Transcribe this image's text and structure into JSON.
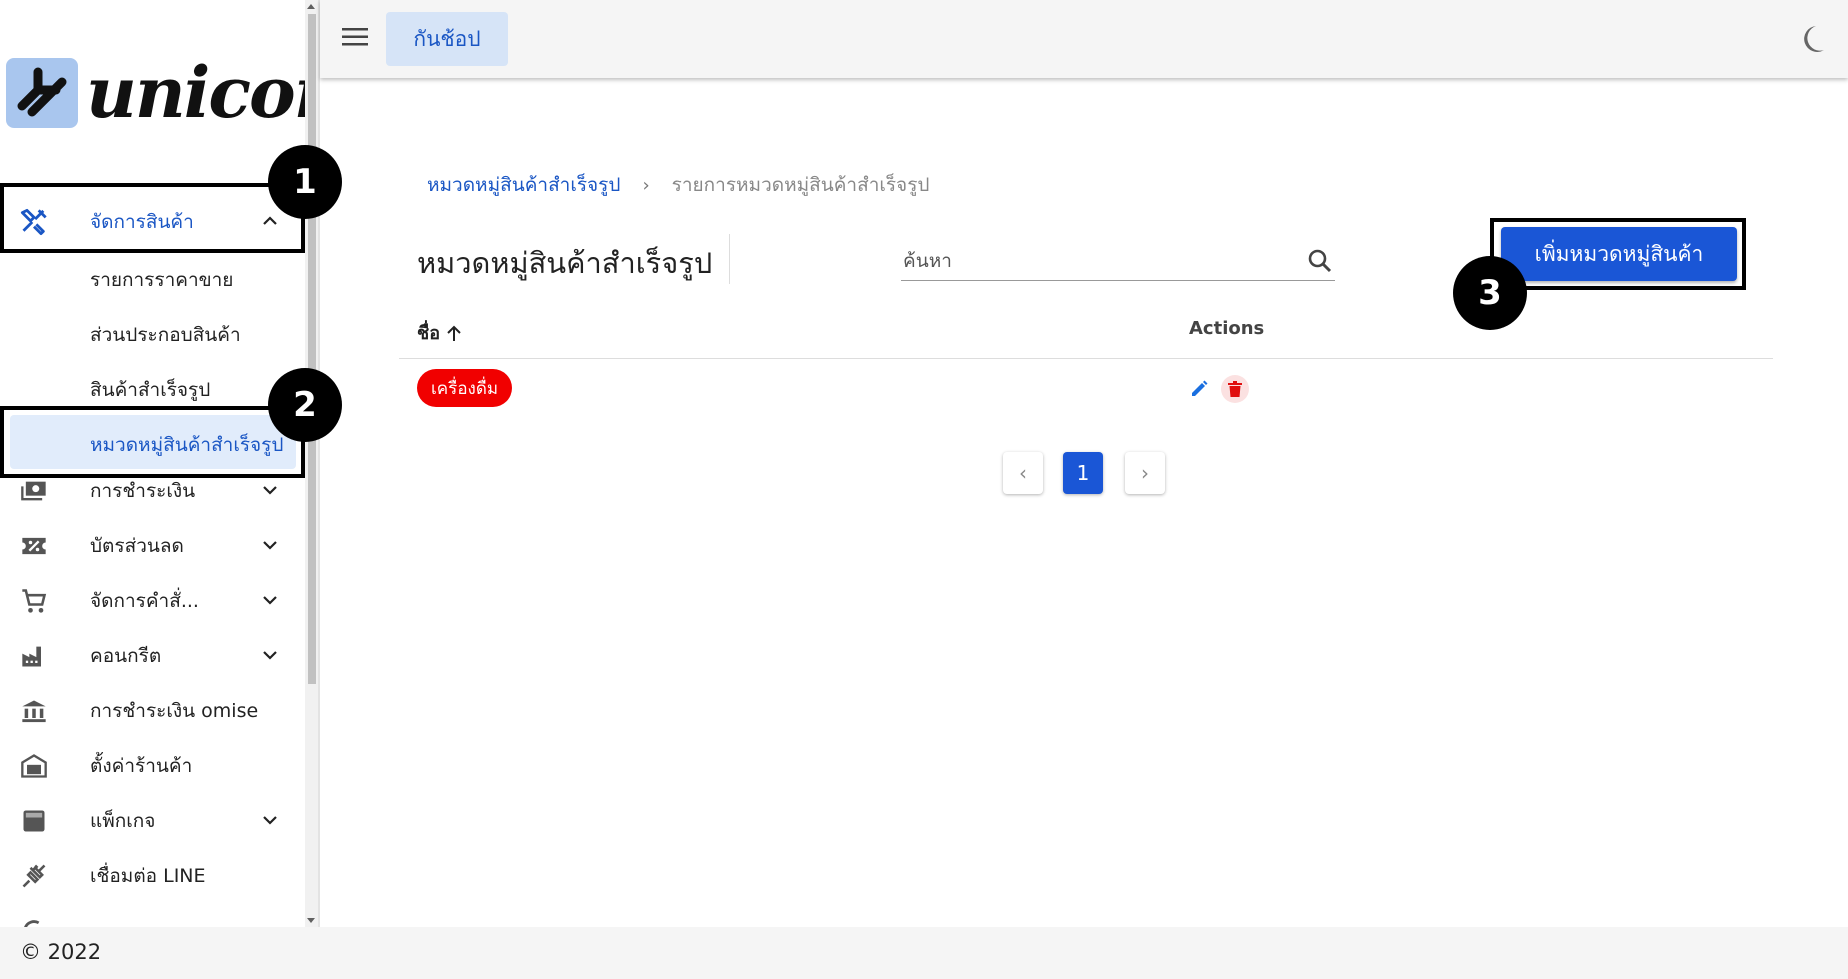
{
  "app": {
    "logo_text": "unicon",
    "shop_button": "กันช้อป"
  },
  "sidebar": {
    "items": [
      {
        "label": "จัดการสินค้า",
        "icon": "tools-icon",
        "expanded": true
      },
      {
        "label": "การชำระเงิน",
        "icon": "payments-icon",
        "expanded": false
      },
      {
        "label": "บัตรส่วนลด",
        "icon": "discount-ticket-icon",
        "expanded": false
      },
      {
        "label": "จัดการคำสั่...",
        "icon": "cart-icon",
        "expanded": false
      },
      {
        "label": "คอนกรีต",
        "icon": "factory-icon",
        "expanded": false
      },
      {
        "label": "การชำระเงิน omise",
        "icon": "bank-icon"
      },
      {
        "label": "ตั้งค่าร้านค้า",
        "icon": "store-icon"
      },
      {
        "label": "แพ็กเกจ",
        "icon": "package-icon",
        "expanded": false
      },
      {
        "label": "เชื่อมต่อ LINE",
        "icon": "plug-icon"
      }
    ],
    "sub_items": [
      {
        "label": "รายการราคาขาย"
      },
      {
        "label": "ส่วนประกอบสินค้า"
      },
      {
        "label": "สินค้าสำเร็จรูป"
      },
      {
        "label": "หมวดหมู่สินค้าสำเร็จรูป",
        "selected": true
      }
    ]
  },
  "annotations": [
    "1",
    "2",
    "3"
  ],
  "breadcrumb": {
    "link": "หมวดหมู่สินค้าสำเร็จรูป",
    "separator": "›",
    "current": "รายการหมวดหมู่สินค้าสำเร็จรูป"
  },
  "main": {
    "title": "หมวดหมู่สินค้าสำเร็จรูป",
    "search_placeholder": "ค้นหา",
    "add_button": "เพิ่มหมวดหมู่สินค้า"
  },
  "table": {
    "columns": [
      "ชื่อ",
      "Actions"
    ],
    "rows": [
      {
        "name": "เครื่องดื่ม",
        "chip_color": "#f10000"
      }
    ]
  },
  "pagination": {
    "prev": "‹",
    "current": "1",
    "next": "›"
  },
  "footer": {
    "text": "© 2022"
  },
  "colors": {
    "primary": "#1a56d6",
    "selected_bg": "#e1ecfb",
    "chip_red": "#f10000"
  }
}
